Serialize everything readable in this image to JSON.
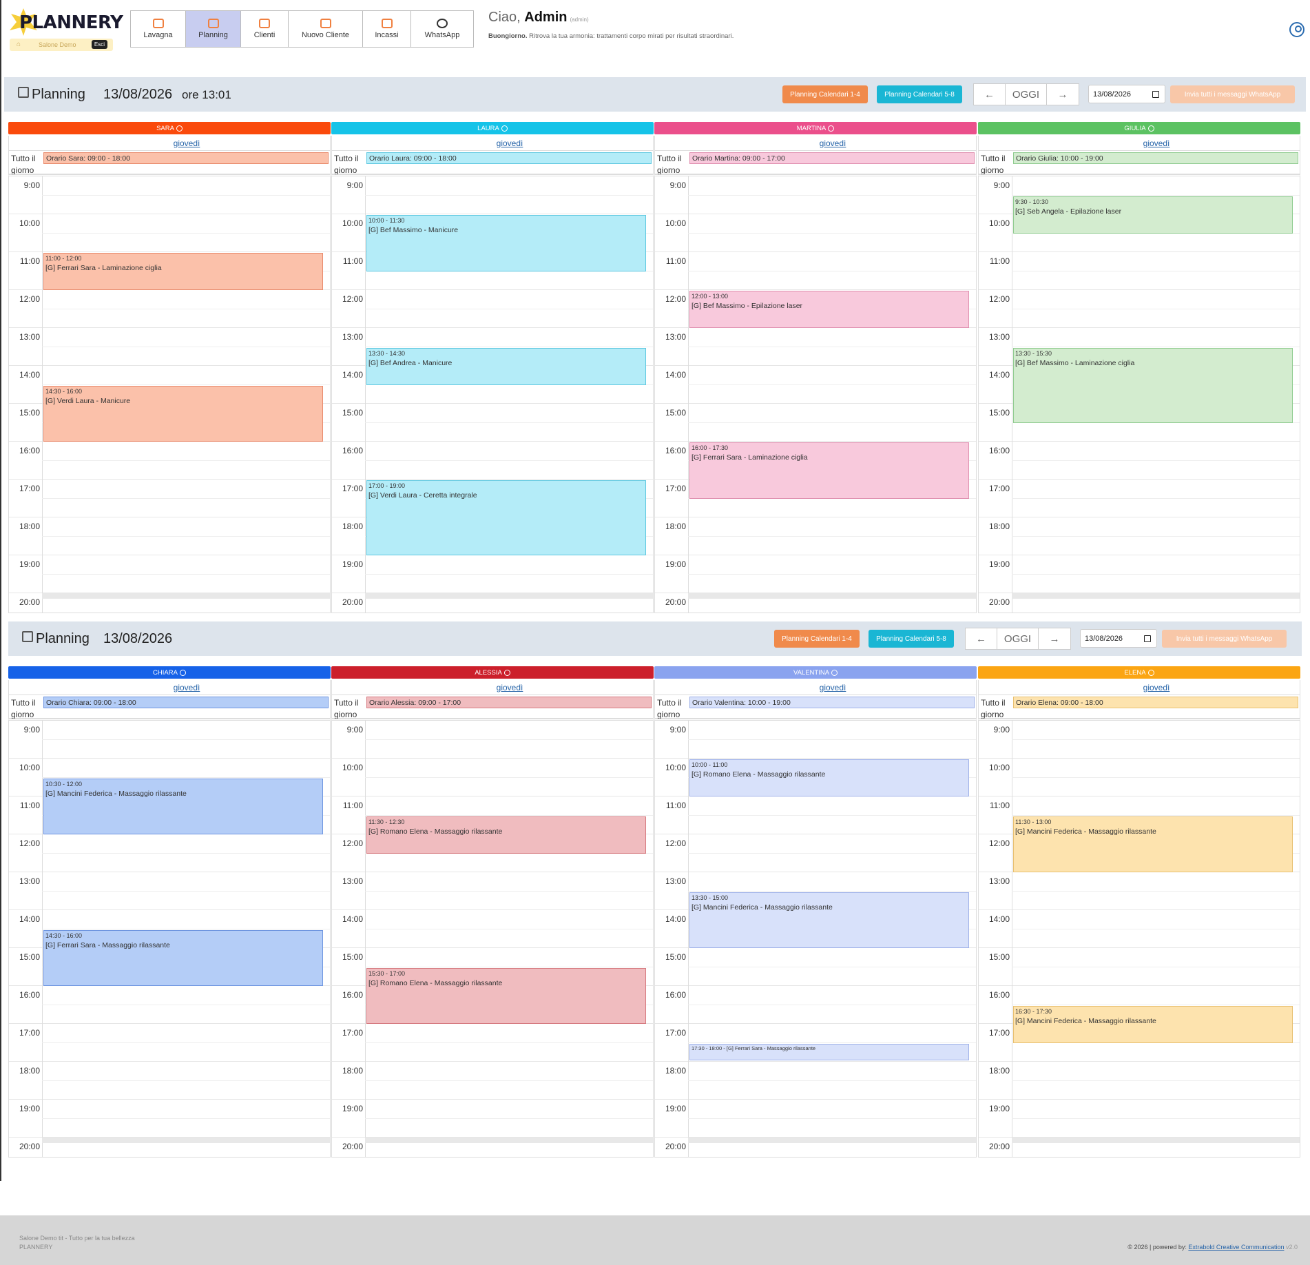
{
  "app": {
    "logo": "PLANNERY",
    "store_name": "Salone Demo",
    "logout": "Esci"
  },
  "nav": [
    {
      "label": "Lavagna",
      "icon": "dashboard-icon"
    },
    {
      "label": "Planning",
      "icon": "calendar-icon",
      "active": true
    },
    {
      "label": "Clienti",
      "icon": "users-icon"
    },
    {
      "label": "Nuovo Cliente",
      "icon": "user-plus-icon"
    },
    {
      "label": "Incassi",
      "icon": "cash-icon"
    },
    {
      "label": "WhatsApp",
      "icon": "whatsapp-icon"
    }
  ],
  "greeting": {
    "hello": "Ciao,",
    "user": "Admin",
    "role": "(admin)",
    "msg_bold": "Buongiorno.",
    "msg": "Ritrova la tua armonia: trattamenti corpo mirati per risultati straordinari."
  },
  "planning": [
    {
      "title": "Planning",
      "date": "13/08/2026",
      "time": "ore 13:01",
      "btn_1_4": "Planning Calendari 1-4",
      "btn_5_8": "Planning Calendari 5-8",
      "prev": "←",
      "today": "OGGI",
      "next": "→",
      "date_input": "13/08/2026",
      "wa_btn": "Invia tutti i messaggi WhatsApp",
      "columns": [
        {
          "name": "SARA",
          "color": "#fa4a0c",
          "bg": "#fbc1aa",
          "border": "#e88a6c",
          "day": "giovedì",
          "allday_label": "Tutto il giorno",
          "schedule": "Orario Sara: 09:00 - 18:00",
          "events": [
            {
              "time": "11:00 - 12:00",
              "text": "[G] Ferrari Sara - Laminazione ciglia",
              "start": 11,
              "end": 12
            },
            {
              "time": "14:30 - 16:00",
              "text": "[G] Verdi Laura - Manicure",
              "start": 14.5,
              "end": 16
            }
          ]
        },
        {
          "name": "LAURA",
          "color": "#15c3e8",
          "bg": "#b4ecf8",
          "border": "#5fc8e0",
          "day": "giovedì",
          "allday_label": "Tutto il giorno",
          "schedule": "Orario Laura: 09:00 - 18:00",
          "events": [
            {
              "time": "10:00 - 11:30",
              "text": "[G] Bef Massimo - Manicure",
              "start": 10,
              "end": 11.5
            },
            {
              "time": "13:30 - 14:30",
              "text": "[G] Bef Andrea - Manicure",
              "start": 13.5,
              "end": 14.5
            },
            {
              "time": "17:00 - 19:00",
              "text": "[G] Verdi Laura - Ceretta integrale",
              "start": 17,
              "end": 19
            }
          ]
        },
        {
          "name": "MARTINA",
          "color": "#eb4f8b",
          "bg": "#f8c9dc",
          "border": "#e090b0",
          "day": "giovedì",
          "allday_label": "Tutto il giorno",
          "schedule": "Orario Martina: 09:00 - 17:00",
          "events": [
            {
              "time": "12:00 - 13:00",
              "text": "[G] Bef Massimo - Epilazione laser",
              "start": 12,
              "end": 13
            },
            {
              "time": "16:00 - 17:30",
              "text": "[G] Ferrari Sara - Laminazione ciglia",
              "start": 16,
              "end": 17.5
            }
          ]
        },
        {
          "name": "GIULIA",
          "color": "#5cc262",
          "bg": "#d3eccf",
          "border": "#90cc90",
          "day": "giovedì",
          "allday_label": "Tutto il giorno",
          "schedule": "Orario Giulia: 10:00 - 19:00",
          "events": [
            {
              "time": "9:30 - 10:30",
              "text": "[G] Seb Angela - Epilazione laser",
              "start": 9.5,
              "end": 10.5
            },
            {
              "time": "13:30 - 15:30",
              "text": "[G] Bef Massimo - Laminazione ciglia",
              "start": 13.5,
              "end": 15.5
            }
          ]
        }
      ]
    },
    {
      "title": "Planning",
      "date": "13/08/2026",
      "time": "",
      "btn_1_4": "Planning Calendari 1-4",
      "btn_5_8": "Planning Calendari 5-8",
      "prev": "←",
      "today": "OGGI",
      "next": "→",
      "date_input": "13/08/2026",
      "wa_btn": "Invia tutti i messaggi WhatsApp",
      "columns": [
        {
          "name": "CHIARA",
          "color": "#1662e8",
          "bg": "#b4cdf7",
          "border": "#6e95e0",
          "day": "giovedì",
          "allday_label": "Tutto il giorno",
          "schedule": "Orario Chiara: 09:00 - 18:00",
          "events": [
            {
              "time": "10:30 - 12:00",
              "text": "[G] Mancini Federica - Massaggio rilassante",
              "start": 10.5,
              "end": 12
            },
            {
              "time": "14:30 - 16:00",
              "text": "[G] Ferrari Sara - Massaggio rilassante",
              "start": 14.5,
              "end": 16
            }
          ]
        },
        {
          "name": "ALESSIA",
          "color": "#cc1f2b",
          "bg": "#f0bcbf",
          "border": "#d67a80",
          "day": "giovedì",
          "allday_label": "Tutto il giorno",
          "schedule": "Orario Alessia: 09:00 - 17:00",
          "events": [
            {
              "time": "11:30 - 12:30",
              "text": "[G] Romano Elena - Massaggio rilassante",
              "start": 11.5,
              "end": 12.5
            },
            {
              "time": "15:30 - 17:00",
              "text": "[G] Romano Elena - Massaggio rilassante",
              "start": 15.5,
              "end": 17
            }
          ]
        },
        {
          "name": "VALENTINA",
          "color": "#8aa3ef",
          "bg": "#d8e1fa",
          "border": "#9fb1e8",
          "day": "giovedì",
          "allday_label": "Tutto il giorno",
          "schedule": "Orario Valentina: 10:00 - 19:00",
          "events": [
            {
              "time": "10:00 - 11:00",
              "text": "[G] Romano Elena - Massaggio rilassante",
              "start": 10,
              "end": 11
            },
            {
              "time": "13:30 - 15:00",
              "text": "[G] Mancini Federica - Massaggio rilassante",
              "start": 13.5,
              "end": 15
            },
            {
              "time": "17:30 - 18:00 - [G] Ferrari Sara - Massaggio rilassante",
              "text": "",
              "start": 17.5,
              "end": 18,
              "compact": true
            }
          ]
        },
        {
          "name": "ELENA",
          "color": "#fba513",
          "bg": "#fde3ae",
          "border": "#e8c070",
          "day": "giovedì",
          "allday_label": "Tutto il giorno",
          "schedule": "Orario Elena: 09:00 - 18:00",
          "events": [
            {
              "time": "11:30 - 13:00",
              "text": "[G] Mancini Federica - Massaggio rilassante",
              "start": 11.5,
              "end": 13
            },
            {
              "time": "16:30 - 17:30",
              "text": "[G] Mancini Federica - Massaggio rilassante",
              "start": 16.5,
              "end": 17.5
            }
          ]
        }
      ]
    }
  ],
  "hours": [
    "9:00",
    "10:00",
    "11:00",
    "12:00",
    "13:00",
    "14:00",
    "15:00",
    "16:00",
    "17:00",
    "18:00",
    "19:00",
    "20:00"
  ],
  "footer": {
    "line1": "Salone Demo tit - Tutto per la tua bellezza",
    "line2": "PLANNERY",
    "copyright": "© 2026 | powered by:",
    "link": "Extrabold Creative Communication",
    "version": "v2.0"
  }
}
